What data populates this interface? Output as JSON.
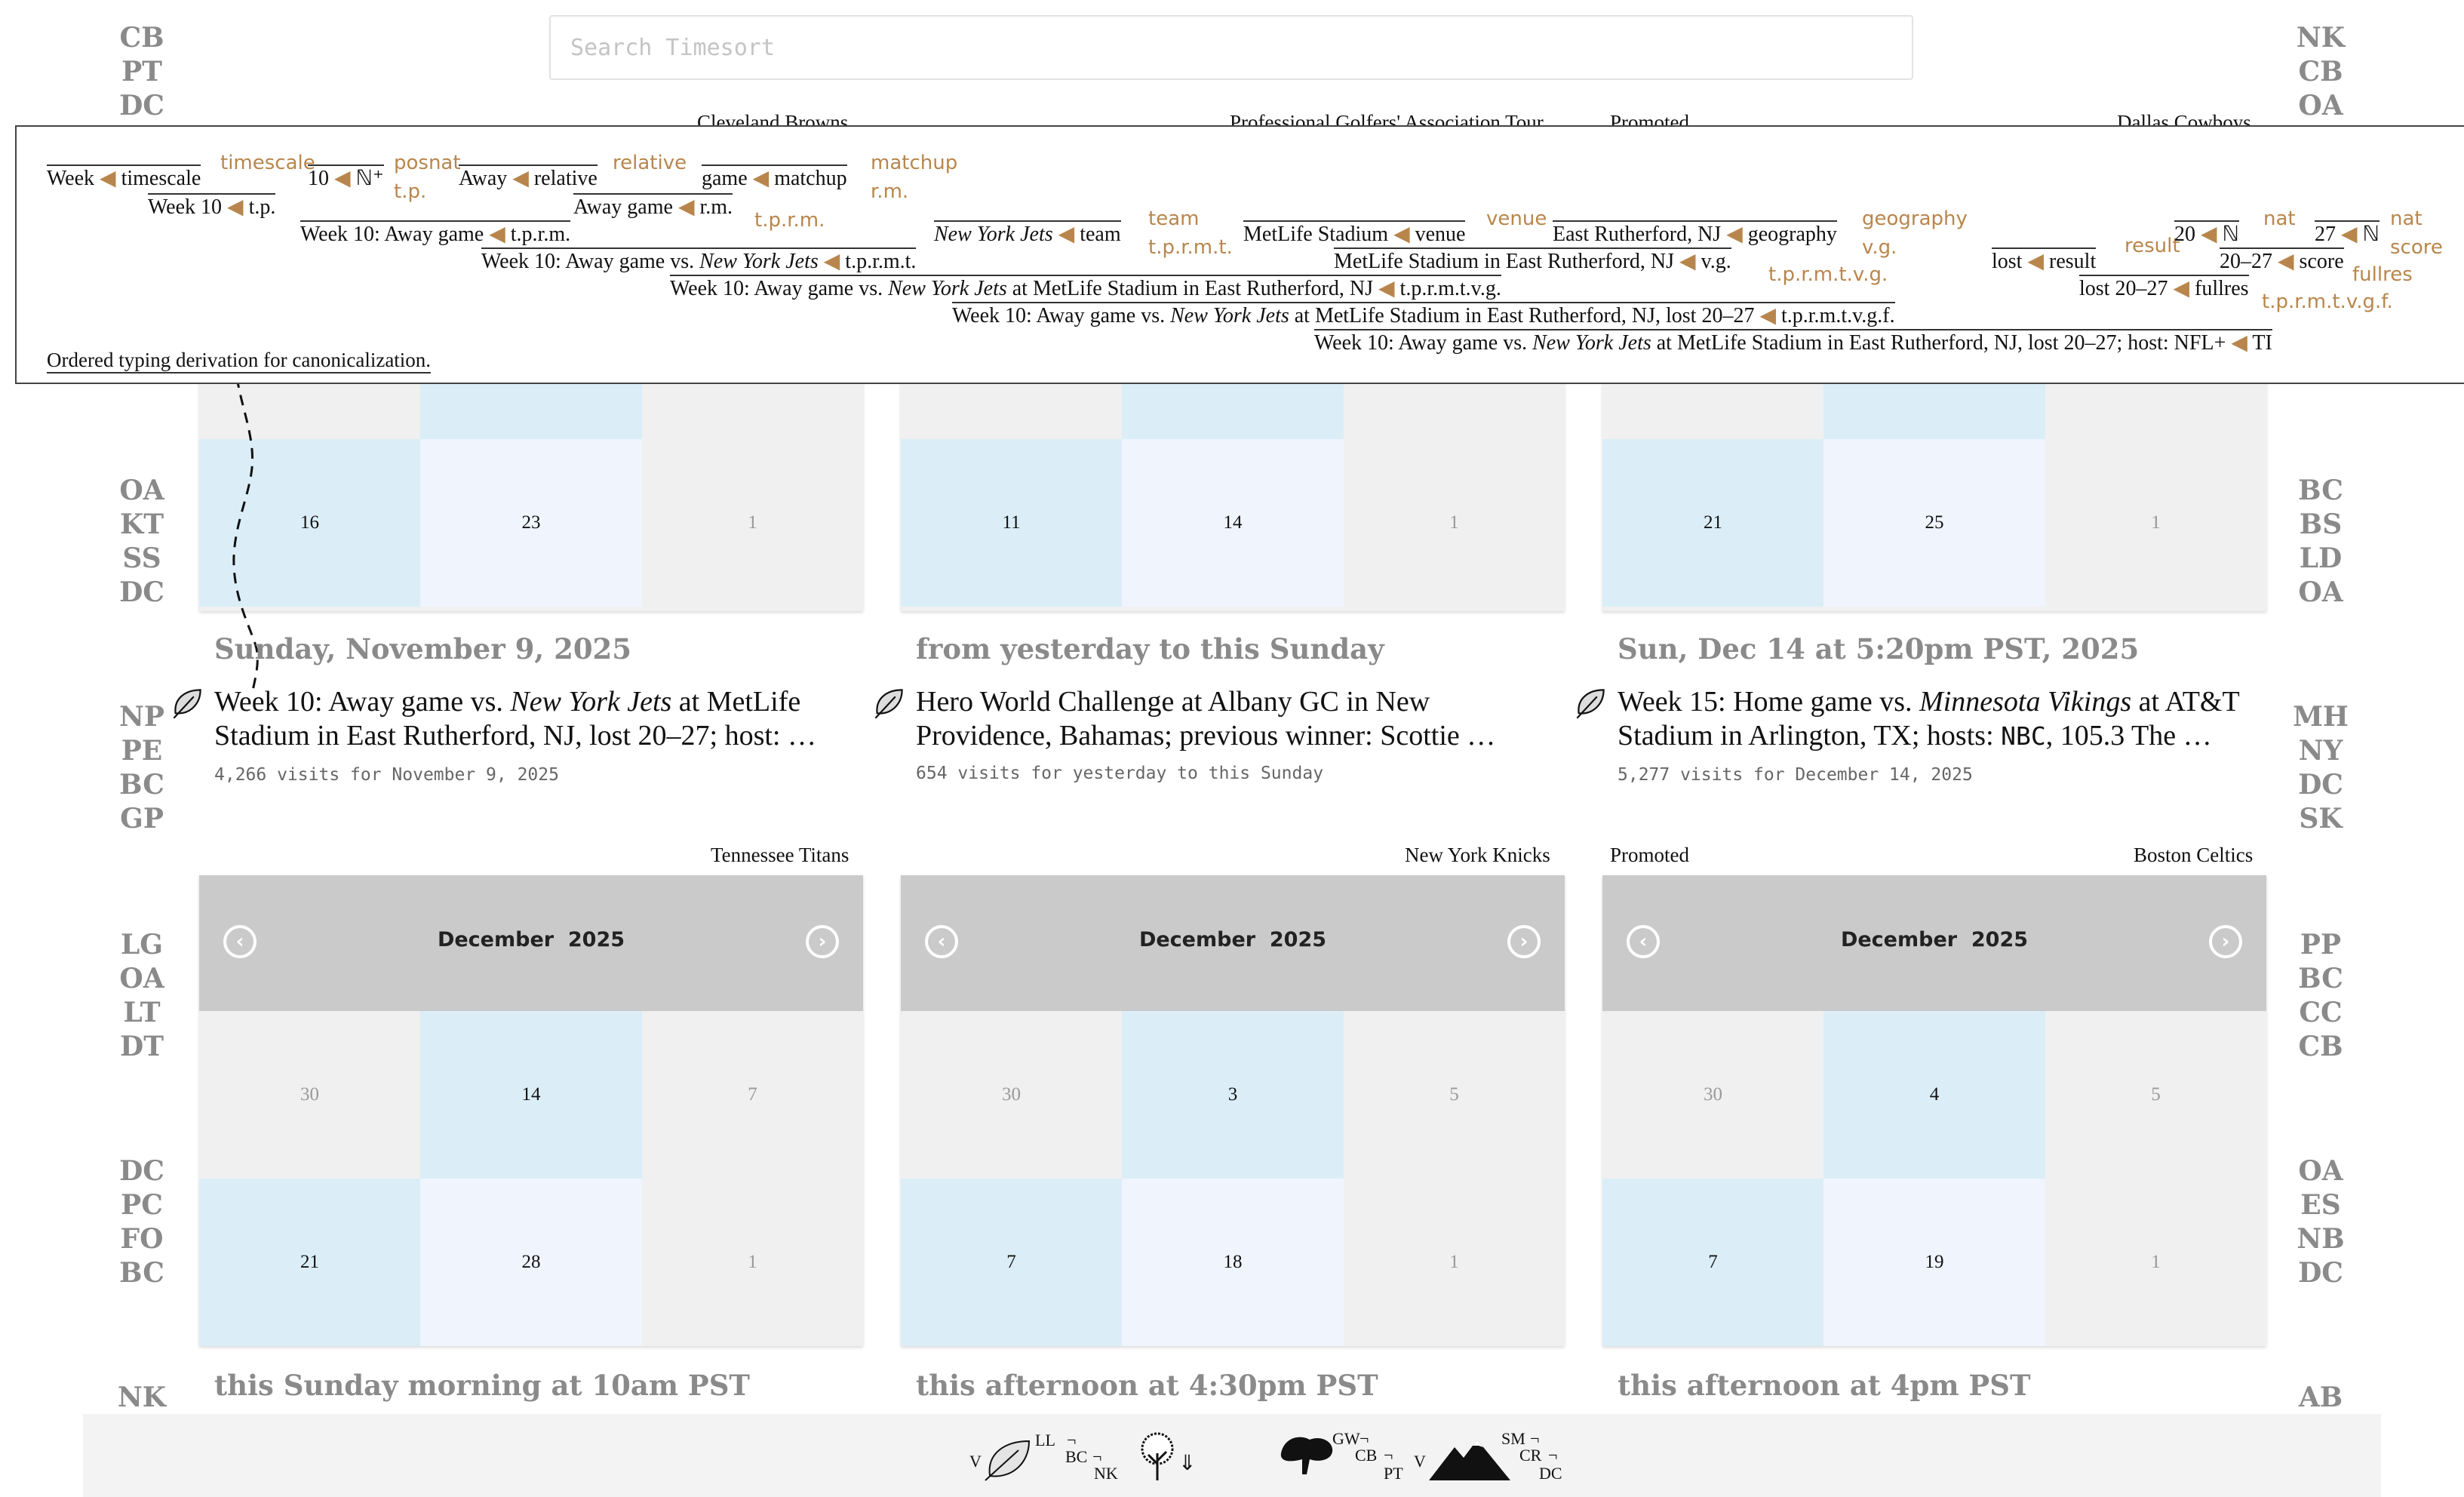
{
  "search": {
    "placeholder": "Search Timesort"
  },
  "side_left": [
    [
      "CB",
      "PT",
      "DC"
    ],
    [
      "OA",
      "KT",
      "SS",
      "DC"
    ],
    [
      "NP",
      "PE",
      "BC",
      "GP"
    ],
    [
      "LG",
      "OA",
      "LT",
      "DT"
    ],
    [
      "DC",
      "PC",
      "FO",
      "BC"
    ],
    [
      "NK"
    ]
  ],
  "side_right": [
    [
      "NK",
      "CB",
      "OA"
    ],
    [
      "BC",
      "BS",
      "LD",
      "OA"
    ],
    [
      "MH",
      "NY",
      "DC",
      "SK"
    ],
    [
      "PP",
      "BC",
      "CC",
      "CB"
    ],
    [
      "OA",
      "ES",
      "NB",
      "DC"
    ],
    [
      "AB"
    ]
  ],
  "top_labels": {
    "c1_right": "Cleveland Browns",
    "c2_right": "Professional Golfers' Association Tour",
    "c3_left": "Promoted",
    "c3_right": "Dallas Cowboys"
  },
  "derivation": {
    "r1_week": "Week",
    "r1_timescale": "timescale",
    "r1_tag_timescale": "timescale",
    "r1_10": "10",
    "r1_N": "ℕ⁺",
    "r1_tag_posnat": "posnat",
    "r1_away": "Away",
    "r1_relative": "relative",
    "r1_tag_relative": "relative",
    "r1_game": "game",
    "r1_matchup": "matchup",
    "r1_tag_matchup": "matchup",
    "r2_tp_tag": "t.p.",
    "r2_week10": "Week 10",
    "r2_tp": "t.p.",
    "r2_awaygame": "Away game",
    "r2_rm": "r.m.",
    "r2_rm_tag": "r.m.",
    "r3_tprm_tag": "t.p.r.m.",
    "r3_text": "Week 10: Away game",
    "r3_tprm": "t.p.r.m.",
    "r3_team_text": "New York Jets",
    "r3_team": "team",
    "r3_team_tag": "team",
    "r3_venue_text": "MetLife Stadium",
    "r3_venue": "venue",
    "r3_venue_tag": "venue",
    "r3_geo_text": "East Rutherford, NJ",
    "r3_geo": "geography",
    "r3_geo_tag": "geography",
    "r4_tprmt_tag": "t.p.r.m.t.",
    "r4_pre": "Week 10: Away game vs. ",
    "r4_team": "New York Jets",
    "r4_code": "t.p.r.m.t.",
    "r4_vg_text": "MetLife Stadium in East Rutherford, NJ",
    "r4_vg": "v.g.",
    "r4_vg_tag": "v.g.",
    "r4_lost": "lost",
    "r4_result": "result",
    "r4_result_tag": "result",
    "r4_20": "20",
    "r4_nat1": "ℕ",
    "r4_nat1_tag": "nat",
    "r4_27": "27",
    "r4_nat2": "ℕ",
    "r4_nat2_tag": "nat",
    "r4_score_text": "20–27",
    "r4_score": "score",
    "r4_score_tag": "score",
    "r5_tag": "t.p.r.m.t.v.g.",
    "r5_pre": "Week 10: Away game vs. ",
    "r5_team": "New York Jets",
    "r5_post": " at MetLife Stadium in East Rutherford, NJ",
    "r5_code": "t.p.r.m.t.v.g.",
    "r5_fullres_text": "lost 20–27",
    "r5_fullres": "fullres",
    "r5_fullres_tag": "fullres",
    "r6_tag": "t.p.r.m.t.v.g.f.",
    "r6_pre": "Week 10: Away game vs. ",
    "r6_team": "New York Jets",
    "r6_post": " at MetLife Stadium in East Rutherford, NJ, lost 20–27",
    "r6_code": "t.p.r.m.t.v.g.f.",
    "r7_pre": "Week 10: Away game vs. ",
    "r7_team": "New York Jets",
    "r7_post": " at MetLife Stadium in East Rutherford, NJ, lost 20–27; host: NFL+",
    "r7_code": "TI",
    "caption": "Ordered typing derivation for canonicalization."
  },
  "row1_cells": [
    [
      {
        "d": "16"
      },
      {
        "d": "23"
      },
      {
        "d": "1"
      }
    ],
    [
      {
        "d": "11"
      },
      {
        "d": "14"
      },
      {
        "d": "1"
      }
    ],
    [
      {
        "d": "21"
      },
      {
        "d": "25"
      },
      {
        "d": "1"
      }
    ]
  ],
  "row1_cards": [
    {
      "date": "Sunday, November 9, 2025",
      "pre": "Week 10: Away game vs. ",
      "em": "New York Jets",
      "post": " at MetLife Stadium in East Rutherford, NJ, lost 20–27; host: …",
      "visits": "4,266 visits for November 9, 2025"
    },
    {
      "date": "from yesterday to this Sunday",
      "pre": "Hero World Challenge at Albany GC in New Providence, Bahamas; previous winner: Scottie …",
      "em": "",
      "post": "",
      "visits": "654 visits for yesterday to this Sunday"
    },
    {
      "date": "Sun, Dec 14 at 5:20pm PST, 2025",
      "pre": "Week 15: Home game vs. ",
      "em": "Minnesota Vikings",
      "post": " at AT&T Stadium in Arlington, TX; hosts: ",
      "mono": "NBC",
      "post2": ", 105.3 The …",
      "visits": "5,277 visits for December 14, 2025"
    }
  ],
  "row2_cards": [
    {
      "label_left": "",
      "label_right": "Tennessee Titans",
      "month": "December",
      "year": "2025",
      "cells": [
        "30",
        "14",
        "7",
        "21",
        "28",
        "1"
      ],
      "bottom": "this Sunday morning at 10am PST"
    },
    {
      "label_left": "",
      "label_right": "New York Knicks",
      "month": "December",
      "year": "2025",
      "cells": [
        "30",
        "3",
        "5",
        "7",
        "18",
        "1"
      ],
      "bottom": "this afternoon at 4:30pm PST"
    },
    {
      "label_left": "Promoted",
      "label_right": "Boston Celtics",
      "month": "December",
      "year": "2025",
      "cells": [
        "30",
        "4",
        "5",
        "7",
        "19",
        "1"
      ],
      "bottom": "this afternoon at 4pm PST"
    }
  ],
  "footer": {
    "v1": "V",
    "ll": "LL",
    "bc": "BC",
    "nk": "NK",
    "arrows": "⇓",
    "gw": "GW",
    "cb": "CB",
    "pt": "PT",
    "v2": "V",
    "sm": "SM",
    "cr": "CR",
    "dc": "DC",
    "corner": "¬"
  }
}
